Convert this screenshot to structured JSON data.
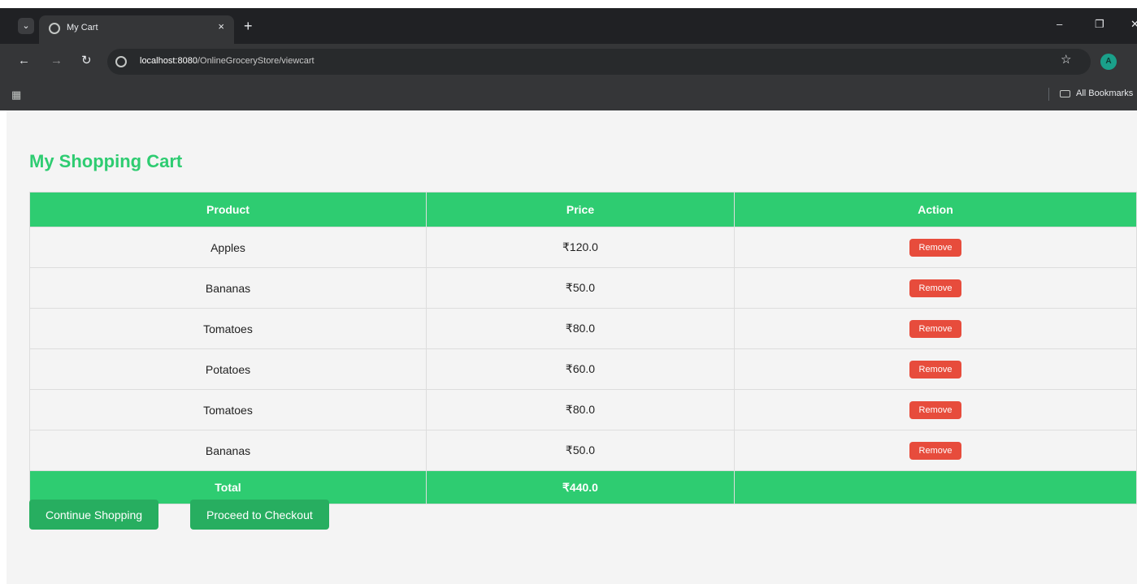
{
  "browser": {
    "tab_title": "My Cart",
    "tab_close": "×",
    "new_tab": "+",
    "url_host": "localhost:8080",
    "url_path": "/OnlineGroceryStore/viewcart",
    "profile_initial": "A",
    "bookmarks_label": "All Bookmarks"
  },
  "page": {
    "title": "My Shopping Cart"
  },
  "table": {
    "headers": [
      "Product",
      "Price",
      "Action"
    ],
    "rows": [
      {
        "product": "Apples",
        "price": "₹120.0",
        "action": "Remove"
      },
      {
        "product": "Bananas",
        "price": "₹50.0",
        "action": "Remove"
      },
      {
        "product": "Tomatoes",
        "price": "₹80.0",
        "action": "Remove"
      },
      {
        "product": "Potatoes",
        "price": "₹60.0",
        "action": "Remove"
      },
      {
        "product": "Tomatoes",
        "price": "₹80.0",
        "action": "Remove"
      },
      {
        "product": "Bananas",
        "price": "₹50.0",
        "action": "Remove"
      }
    ],
    "total_label": "Total",
    "total_value": "₹440.0"
  },
  "buttons": {
    "continue": "Continue Shopping",
    "checkout": "Proceed to Checkout"
  },
  "colors": {
    "accent": "#2ecc71",
    "button": "#27ae60",
    "remove": "#e74c3c",
    "page_bg": "#f4f4f4"
  }
}
